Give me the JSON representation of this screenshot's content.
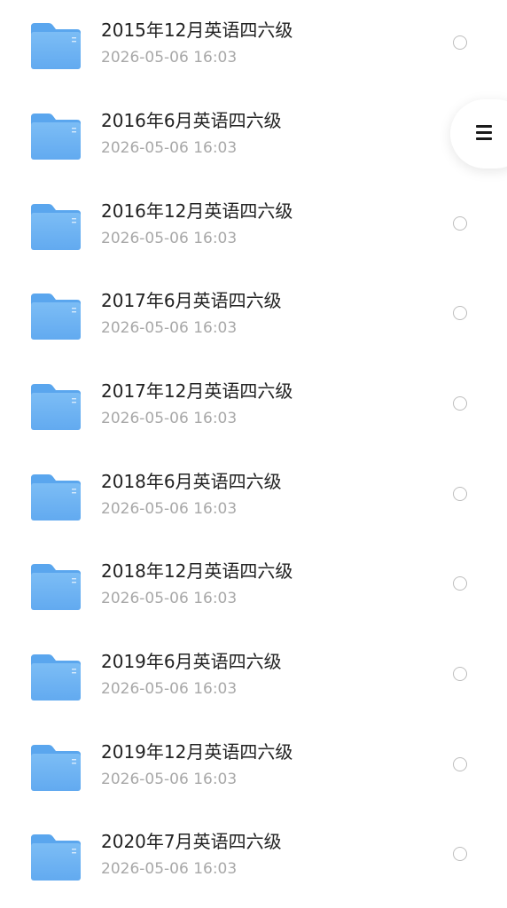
{
  "colors": {
    "folder_fill": "#7cbdf5",
    "folder_tab": "#5aa6ee",
    "title_text": "#222222",
    "time_text": "#a8a8a8",
    "radio_border": "#bdbdbd"
  },
  "icons": {
    "folder": "folder-icon",
    "radio": "radio-unchecked-icon",
    "menu": "menu-icon"
  },
  "files": [
    {
      "title": "2015年12月英语四六级",
      "time": "2026-05-06 16:03",
      "selected": false
    },
    {
      "title": "2016年6月英语四六级",
      "time": "2026-05-06 16:03",
      "selected": false
    },
    {
      "title": "2016年12月英语四六级",
      "time": "2026-05-06 16:03",
      "selected": false
    },
    {
      "title": "2017年6月英语四六级",
      "time": "2026-05-06 16:03",
      "selected": false
    },
    {
      "title": "2017年12月英语四六级",
      "time": "2026-05-06 16:03",
      "selected": false
    },
    {
      "title": "2018年6月英语四六级",
      "time": "2026-05-06 16:03",
      "selected": false
    },
    {
      "title": "2018年12月英语四六级",
      "time": "2026-05-06 16:03",
      "selected": false
    },
    {
      "title": "2019年6月英语四六级",
      "time": "2026-05-06 16:03",
      "selected": false
    },
    {
      "title": "2019年12月英语四六级",
      "time": "2026-05-06 16:03",
      "selected": false
    },
    {
      "title": "2020年7月英语四六级",
      "time": "2026-05-06 16:03",
      "selected": false
    }
  ]
}
